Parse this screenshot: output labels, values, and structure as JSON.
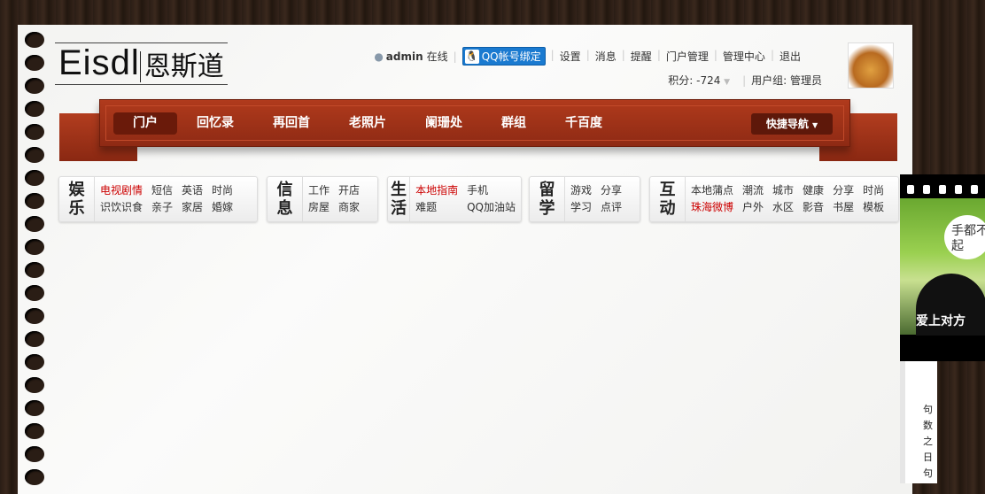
{
  "logo": {
    "en": "Eisdl",
    "cn": "恩斯道"
  },
  "user": {
    "name": "admin",
    "status": "在线",
    "qq_bind": "QQ帐号绑定",
    "links": [
      "设置",
      "消息",
      "提醒",
      "门户管理",
      "管理中心",
      "退出"
    ],
    "credits": "积分: -724",
    "group": "用户组: 管理员"
  },
  "nav": {
    "items": [
      "门户",
      "回忆录",
      "再回首",
      "老照片",
      "阑珊处",
      "群组",
      "千百度"
    ],
    "quick": "快捷导航"
  },
  "categories": [
    {
      "title": "娱乐",
      "cols": 4,
      "links": [
        {
          "t": "电视剧情",
          "red": true
        },
        {
          "t": "短信"
        },
        {
          "t": "英语"
        },
        {
          "t": "时尚"
        },
        {
          "t": "识饮识食"
        },
        {
          "t": "亲子"
        },
        {
          "t": "家居"
        },
        {
          "t": "婚嫁"
        }
      ]
    },
    {
      "title": "信息",
      "cols": 2,
      "links": [
        {
          "t": "工作"
        },
        {
          "t": "开店"
        },
        {
          "t": "房屋"
        },
        {
          "t": "商家"
        }
      ]
    },
    {
      "title": "生活",
      "cols": 2,
      "links": [
        {
          "t": "本地指南",
          "red": true
        },
        {
          "t": "手机"
        },
        {
          "t": "难题"
        },
        {
          "t": "QQ加油站"
        }
      ]
    },
    {
      "title": "留学",
      "cols": 2,
      "links": [
        {
          "t": "游戏"
        },
        {
          "t": "分享"
        },
        {
          "t": "学习"
        },
        {
          "t": "点评"
        }
      ]
    },
    {
      "title": "互动",
      "cols": 6,
      "links": [
        {
          "t": "本地蒲点"
        },
        {
          "t": "潮流"
        },
        {
          "t": "城市"
        },
        {
          "t": "健康"
        },
        {
          "t": "分享"
        },
        {
          "t": "时尚"
        },
        {
          "t": "珠海微博",
          "red": true
        },
        {
          "t": "户外"
        },
        {
          "t": "水区"
        },
        {
          "t": "影音"
        },
        {
          "t": "书屋"
        },
        {
          "t": "模板"
        }
      ]
    }
  ],
  "side": {
    "bubble": "手都不起",
    "caption": "爱上对方",
    "strip": "句数之日句"
  }
}
